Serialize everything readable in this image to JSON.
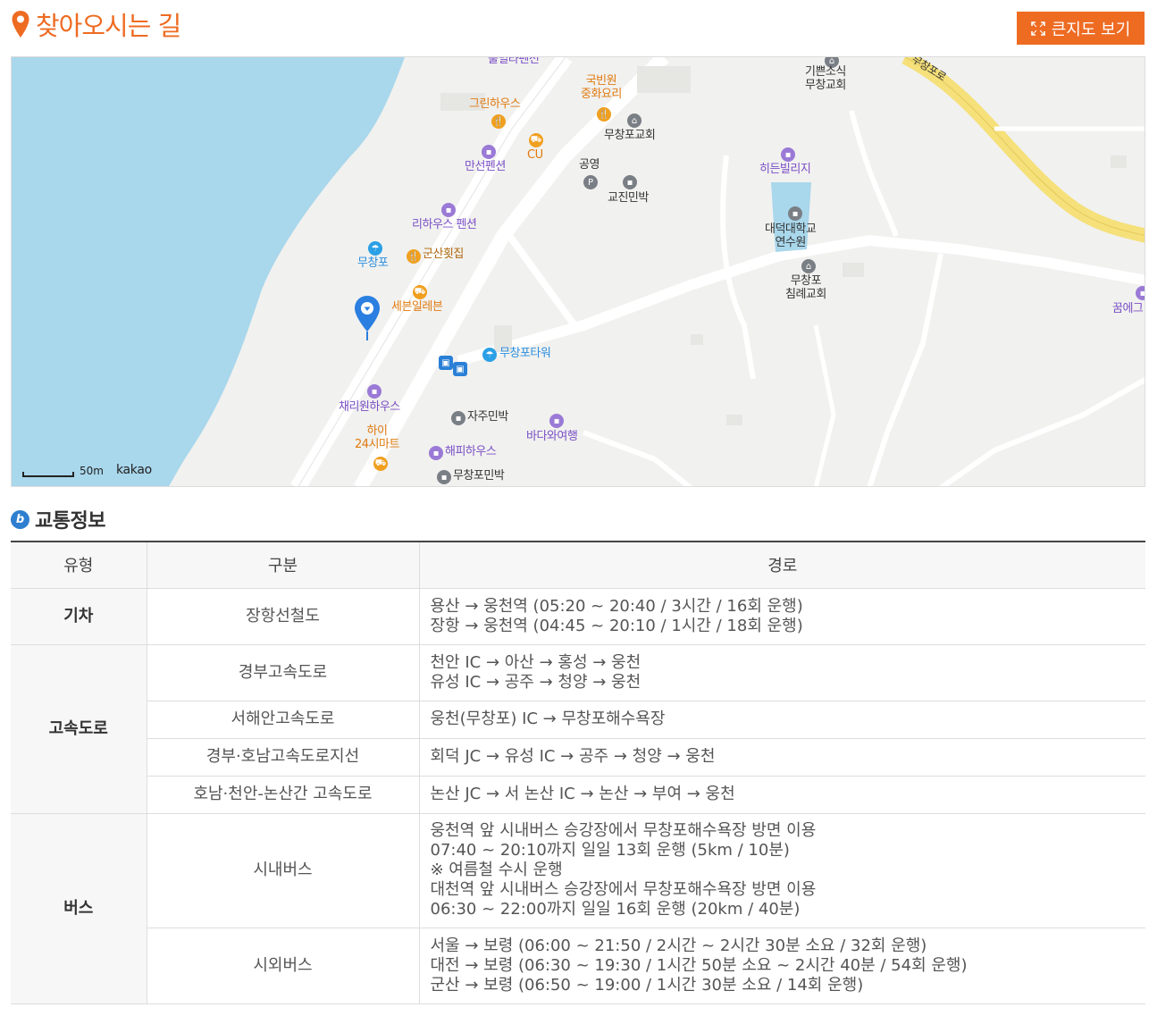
{
  "header": {
    "title": "찾아오시는 길",
    "big_map_label": "큰지도 보기"
  },
  "map": {
    "scale_label": "50m",
    "provider": "kakao",
    "pois": {
      "pulmilla": "풀밀라펜션",
      "gukbin": "국빈원\n중화요리",
      "gippeun": "기쁜소식\n무창교회",
      "muchang_road": "무창포로",
      "green": "그린하우스",
      "muchangpo_church": "무창포교회",
      "cu": "CU",
      "mansun": "만선펜션",
      "gongyeong": "공영",
      "gyojin": "교진민박",
      "hidden": "히든빌리지",
      "rihouse": "리하우스 펜션",
      "daedeok": "대덕대학교\n연수원",
      "muchangpo_beach": "무창포",
      "gunsan": "군산횟집",
      "chimrye": "무창포\n침례교회",
      "seven": "세븐일레븐",
      "kkum": "꿈에그",
      "tower": "무창포타워",
      "chaeri": "채리원하우스",
      "jaju": "자주민박",
      "bada": "바다와여행",
      "hai": "하이\n24시마트",
      "happy": "해피하우스",
      "muchangpo_minbak": "무창포민박"
    }
  },
  "traffic": {
    "title": "교통정보",
    "headers": [
      "유형",
      "구분",
      "경로"
    ],
    "rows": {
      "train": {
        "type": "기차",
        "items": [
          {
            "cat": "장항선철도",
            "lines": [
              "용산 → 웅천역 (05:20 ~ 20:40 / 3시간 / 16회 운행)",
              "장항 → 웅천역 (04:45 ~ 20:10 / 1시간 / 18회 운행)"
            ]
          }
        ]
      },
      "highway": {
        "type": "고속도로",
        "items": [
          {
            "cat": "경부고속도로",
            "lines": [
              "천안 IC → 아산 → 홍성 → 웅천",
              "유성 IC → 공주 → 청양 → 웅천"
            ]
          },
          {
            "cat": "서해안고속도로",
            "lines": [
              "웅천(무창포) IC → 무창포해수욕장"
            ]
          },
          {
            "cat": "경부·호남고속도로지선",
            "lines": [
              "회덕 JC → 유성 IC → 공주 → 청양 → 웅천"
            ]
          },
          {
            "cat": "호남·천안-논산간 고속도로",
            "lines": [
              "논산 JC → 서 논산 IC → 논산 → 부여 → 웅천"
            ]
          }
        ]
      },
      "bus": {
        "type": "버스",
        "items": [
          {
            "cat": "시내버스",
            "lines": [
              "웅천역 앞 시내버스 승강장에서 무창포해수욕장 방면 이용",
              "07:40 ~ 20:10까지 일일 13회 운행 (5km / 10분)",
              "※ 여름철 수시 운행",
              "대천역 앞 시내버스 승강장에서 무창포해수욕장 방면 이용",
              "06:30 ~ 22:00까지 일일 16회 운행 (20km / 40분)"
            ]
          },
          {
            "cat": "시외버스",
            "lines": [
              "서울 → 보령 (06:00 ~ 21:50 / 2시간 ~ 2시간 30분 소요 / 32회 운행)",
              "대전 → 보령 (06:30 ~ 19:30 / 1시간 50분 소요 ~ 2시간 40분 / 54회 운행)",
              "군산 → 보령 (06:50 ~ 19:00 / 1시간 30분 소요 / 14회 운행)"
            ]
          }
        ]
      }
    }
  },
  "colors": {
    "accent": "#ee6b22",
    "sea": "#a9d7ec",
    "road_yellow": "#f5e07a",
    "pin": "#2a7fe0"
  }
}
